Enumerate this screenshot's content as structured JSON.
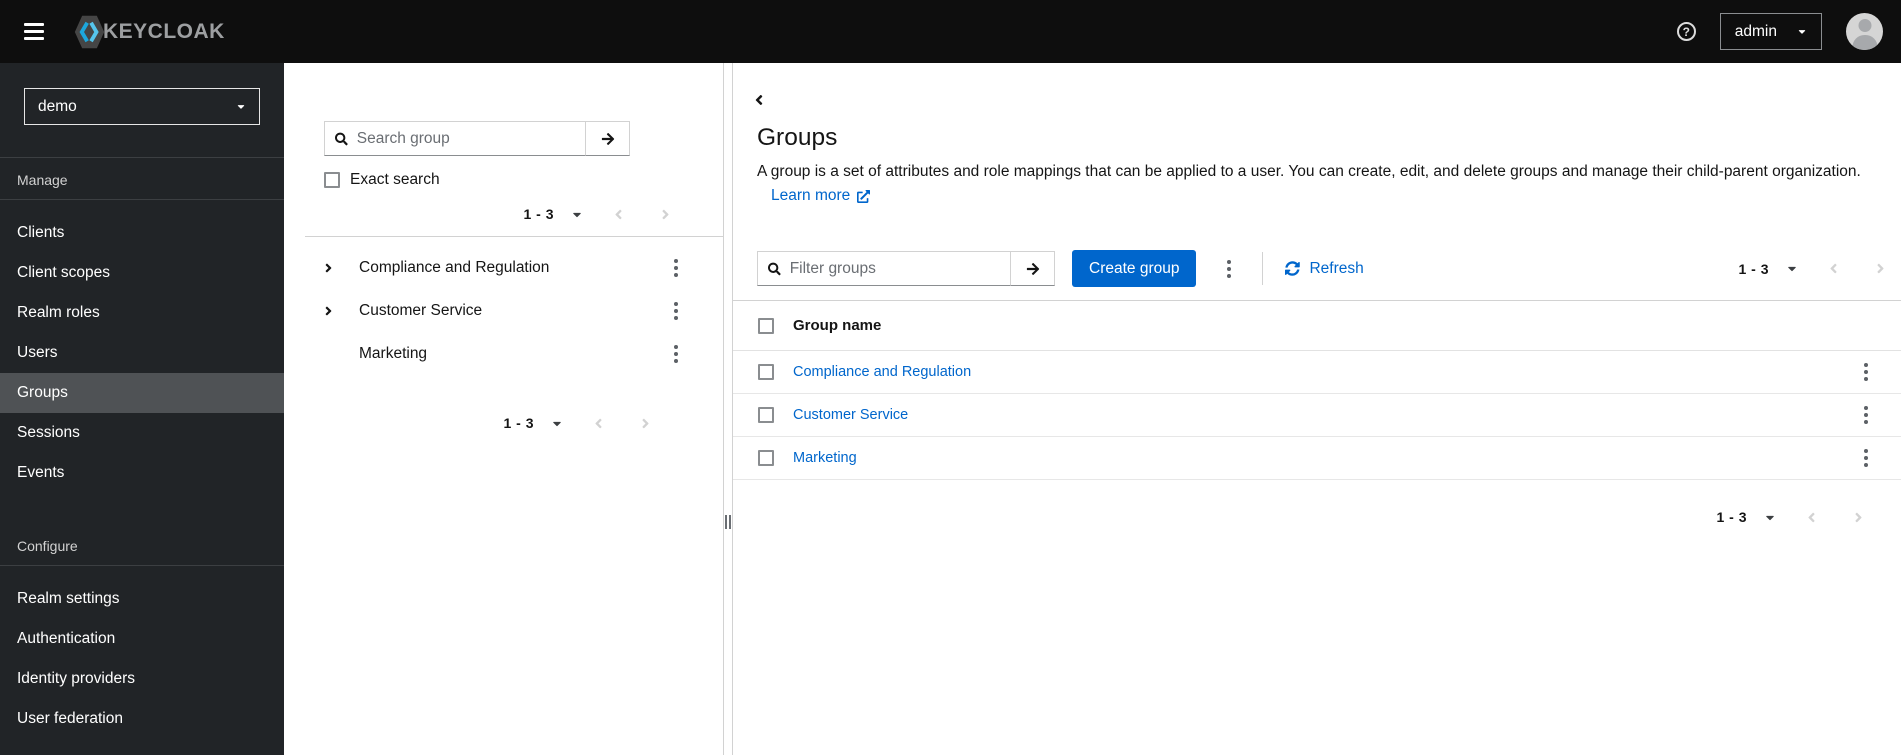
{
  "masthead": {
    "brand": "KEYCLOAK",
    "username": "admin"
  },
  "sidebar": {
    "realm": "demo",
    "manage": {
      "label": "Manage",
      "items": [
        "Clients",
        "Client scopes",
        "Realm roles",
        "Users",
        "Groups",
        "Sessions",
        "Events"
      ],
      "active_item": "Groups"
    },
    "configure": {
      "label": "Configure",
      "items": [
        "Realm settings",
        "Authentication",
        "Identity providers",
        "User federation"
      ]
    }
  },
  "groups_panel": {
    "search_placeholder": "Search group",
    "exact_search_label": "Exact search",
    "pagination_top": "1 - 3",
    "pagination_bottom": "1 - 3",
    "tree": [
      "Compliance and Regulation",
      "Customer Service",
      "Marketing"
    ]
  },
  "main": {
    "title": "Groups",
    "description": "A group is a set of attributes and role mappings that can be applied to a user. You can create, edit, and delete groups and manage their child-parent organization.",
    "learn_more_label": "Learn more",
    "filter_placeholder": "Filter groups",
    "create_button_label": "Create group",
    "refresh_label": "Refresh",
    "pagination_top": "1 - 3",
    "pagination_bottom": "1 - 3",
    "table": {
      "header": "Group name",
      "rows": [
        "Compliance and Regulation",
        "Customer Service",
        "Marketing"
      ]
    }
  },
  "icons": [
    "hamburger-icon",
    "keycloak-logo-icon",
    "help-icon",
    "caret-down-icon",
    "avatar-icon",
    "search-icon",
    "arrow-right-icon",
    "chevron-right-icon",
    "chevron-left-icon",
    "kebab-icon",
    "sync-icon",
    "external-link-icon"
  ],
  "colors": {
    "accent": "#0066cc",
    "masthead_bg": "#0e0e0e",
    "sidebar_bg": "#212427",
    "sidebar_active_bg": "#4f5255",
    "link": "#0066cc",
    "border": "#d2d2d2",
    "disabled": "#d2d2d2",
    "logo_cyan": "#2bb0e2"
  }
}
